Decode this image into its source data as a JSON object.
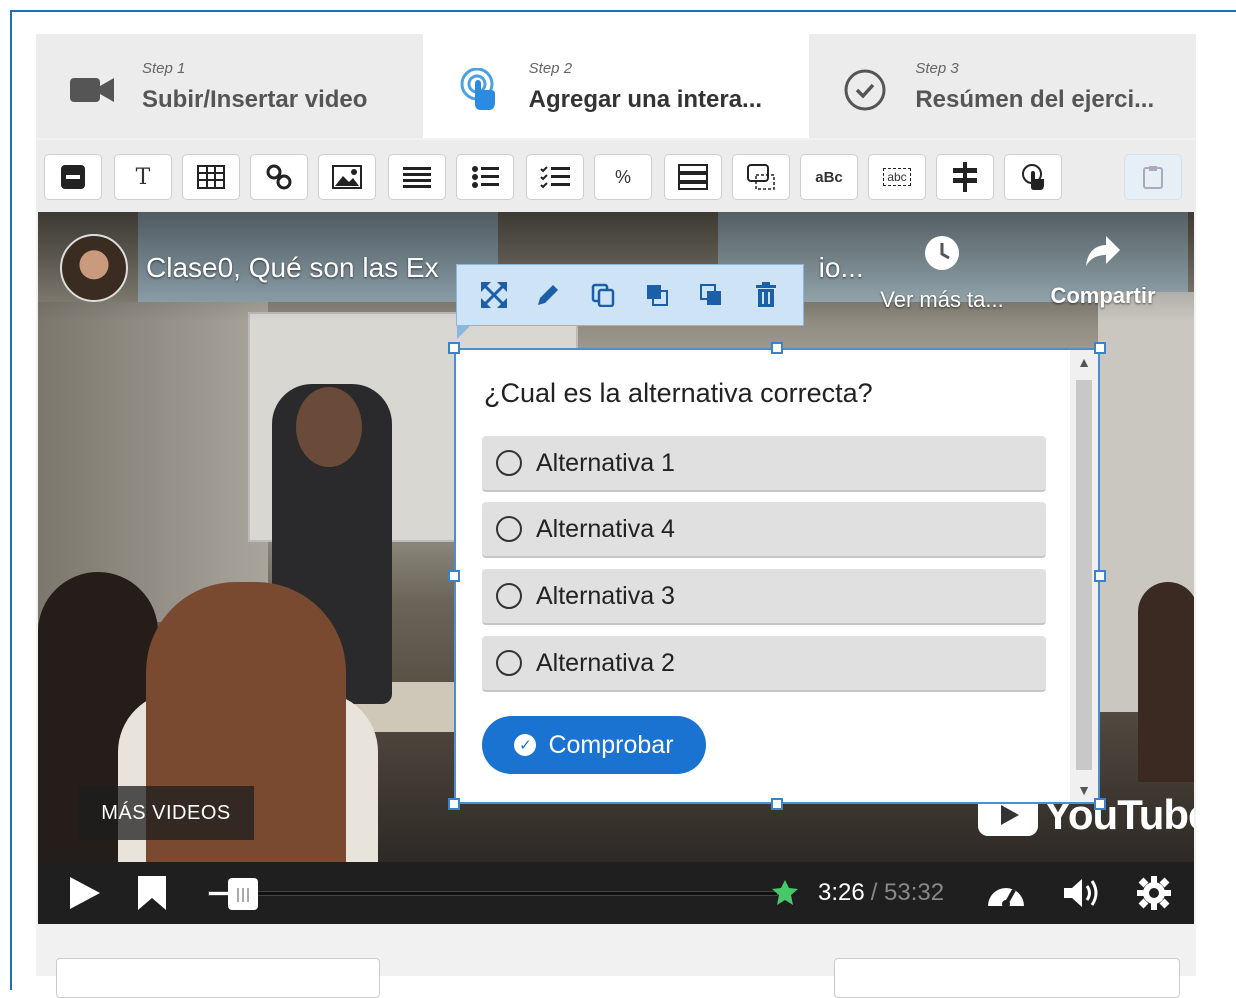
{
  "steps": [
    {
      "sub": "Step 1",
      "title": "Subir/Insertar video",
      "icon": "video-camera-icon"
    },
    {
      "sub": "Step 2",
      "title": "Agregar una intera...",
      "icon": "touch-pointer-icon"
    },
    {
      "sub": "Step 3",
      "title": "Resúmen del ejerci...",
      "icon": "check-circle-icon"
    }
  ],
  "toolbar": {
    "text_glyph": "T",
    "percent_glyph": "%",
    "abc_glyph": "aBc",
    "abc_box_glyph": "abc"
  },
  "video": {
    "title": "Clase0, Qué son las Ex",
    "title_tail": "io...",
    "watch_later": "Ver más ta...",
    "share": "Compartir",
    "more_videos": "MÁS VIDEOS",
    "logo_text": "YouTube",
    "current_time": "3:26",
    "duration": "/ 53:32",
    "progress": 0.064
  },
  "interaction": {
    "question": "¿Cual es la alternativa correcta?",
    "options": [
      "Alternativa 1",
      "Alternativa 4",
      "Alternativa 3",
      "Alternativa 2"
    ],
    "submit_label": "Comprobar"
  },
  "colors": {
    "accent": "#1a73d0",
    "selection": "#4a8fd1"
  }
}
